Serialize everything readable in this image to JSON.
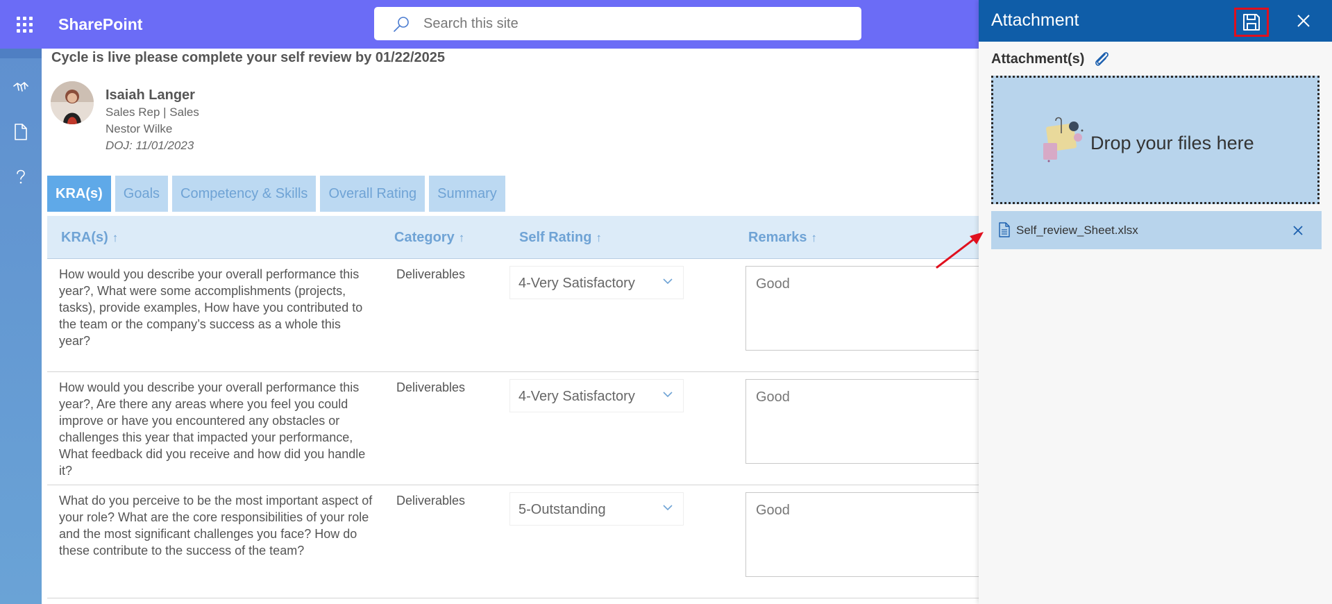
{
  "app": {
    "brand": "SharePoint"
  },
  "search": {
    "placeholder": "Search this site"
  },
  "rail": {
    "icons": [
      "home-icon",
      "handshake-icon",
      "document-icon",
      "help-icon"
    ]
  },
  "banner": "Cycle is live please complete your self review by 01/22/2025",
  "profile": {
    "name": "Isaiah Langer",
    "role": "Sales Rep | Sales",
    "manager": "Nestor Wilke",
    "doj": "DOJ: 11/01/2023"
  },
  "tabs": [
    {
      "label": "KRA(s)",
      "active": true
    },
    {
      "label": "Goals",
      "active": false
    },
    {
      "label": "Competency & Skills",
      "active": false
    },
    {
      "label": "Overall Rating",
      "active": false
    },
    {
      "label": "Summary",
      "active": false
    }
  ],
  "table": {
    "headers": {
      "kra": "KRA(s)",
      "category": "Category",
      "self_rating": "Self Rating",
      "remarks": "Remarks",
      "sort_glyph": "↑"
    },
    "rows": [
      {
        "question": "How would you describe your overall performance this year?, What were some accomplishments (projects, tasks), provide examples, How have you contributed to the team or the company’s success as a whole this year?",
        "category": "Deliverables",
        "rating": "4-Very Satisfactory",
        "remarks": "Good"
      },
      {
        "question": "How would you describe your overall performance this year?, Are there any areas where you feel you could improve or have you encountered any obstacles or challenges this year that impacted your performance, What feedback did you receive and how did you handle it?",
        "category": "Deliverables",
        "rating": "4-Very Satisfactory",
        "remarks": "Good"
      },
      {
        "question": "What do you perceive to be the most important aspect of your role? What are the core responsibilities of your role and the most significant challenges you face? How do these contribute to the success of the team?",
        "category": "Deliverables",
        "rating": "5-Outstanding",
        "remarks": "Good"
      }
    ]
  },
  "panel": {
    "title": "Attachment",
    "attachments_label": "Attachment(s)",
    "dropzone_text": "Drop your files here",
    "files": [
      {
        "name": "Self_review_Sheet.xlsx"
      }
    ]
  },
  "colors": {
    "suite_bar": "#6b6cf6",
    "panel_header": "#0f5da8",
    "tab_active": "#5fa9e8",
    "tab_inactive": "#bcd9f2",
    "highlight_box": "#e0101e"
  }
}
